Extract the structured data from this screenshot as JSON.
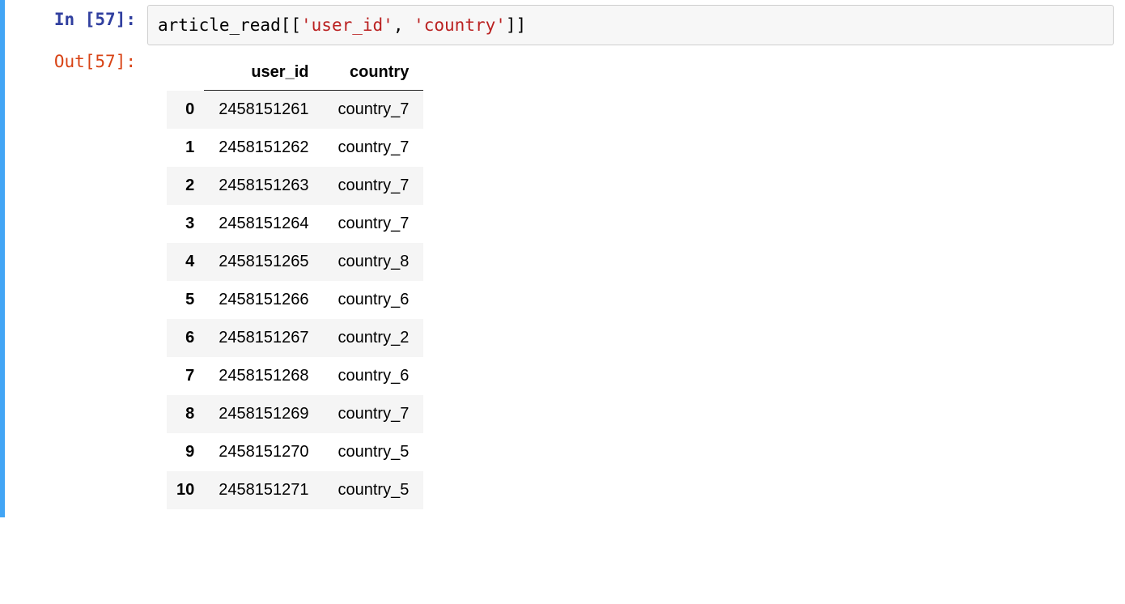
{
  "cell": {
    "in_prompt": "In [57]:",
    "out_prompt": "Out[57]:",
    "code": {
      "p1": "article_read[[",
      "s1": "'user_id'",
      "p2": ", ",
      "s2": "'country'",
      "p3": "]]"
    }
  },
  "table": {
    "columns": [
      "user_id",
      "country"
    ],
    "rows": [
      {
        "idx": "0",
        "user_id": "2458151261",
        "country": "country_7"
      },
      {
        "idx": "1",
        "user_id": "2458151262",
        "country": "country_7"
      },
      {
        "idx": "2",
        "user_id": "2458151263",
        "country": "country_7"
      },
      {
        "idx": "3",
        "user_id": "2458151264",
        "country": "country_7"
      },
      {
        "idx": "4",
        "user_id": "2458151265",
        "country": "country_8"
      },
      {
        "idx": "5",
        "user_id": "2458151266",
        "country": "country_6"
      },
      {
        "idx": "6",
        "user_id": "2458151267",
        "country": "country_2"
      },
      {
        "idx": "7",
        "user_id": "2458151268",
        "country": "country_6"
      },
      {
        "idx": "8",
        "user_id": "2458151269",
        "country": "country_7"
      },
      {
        "idx": "9",
        "user_id": "2458151270",
        "country": "country_5"
      },
      {
        "idx": "10",
        "user_id": "2458151271",
        "country": "country_5"
      }
    ]
  }
}
